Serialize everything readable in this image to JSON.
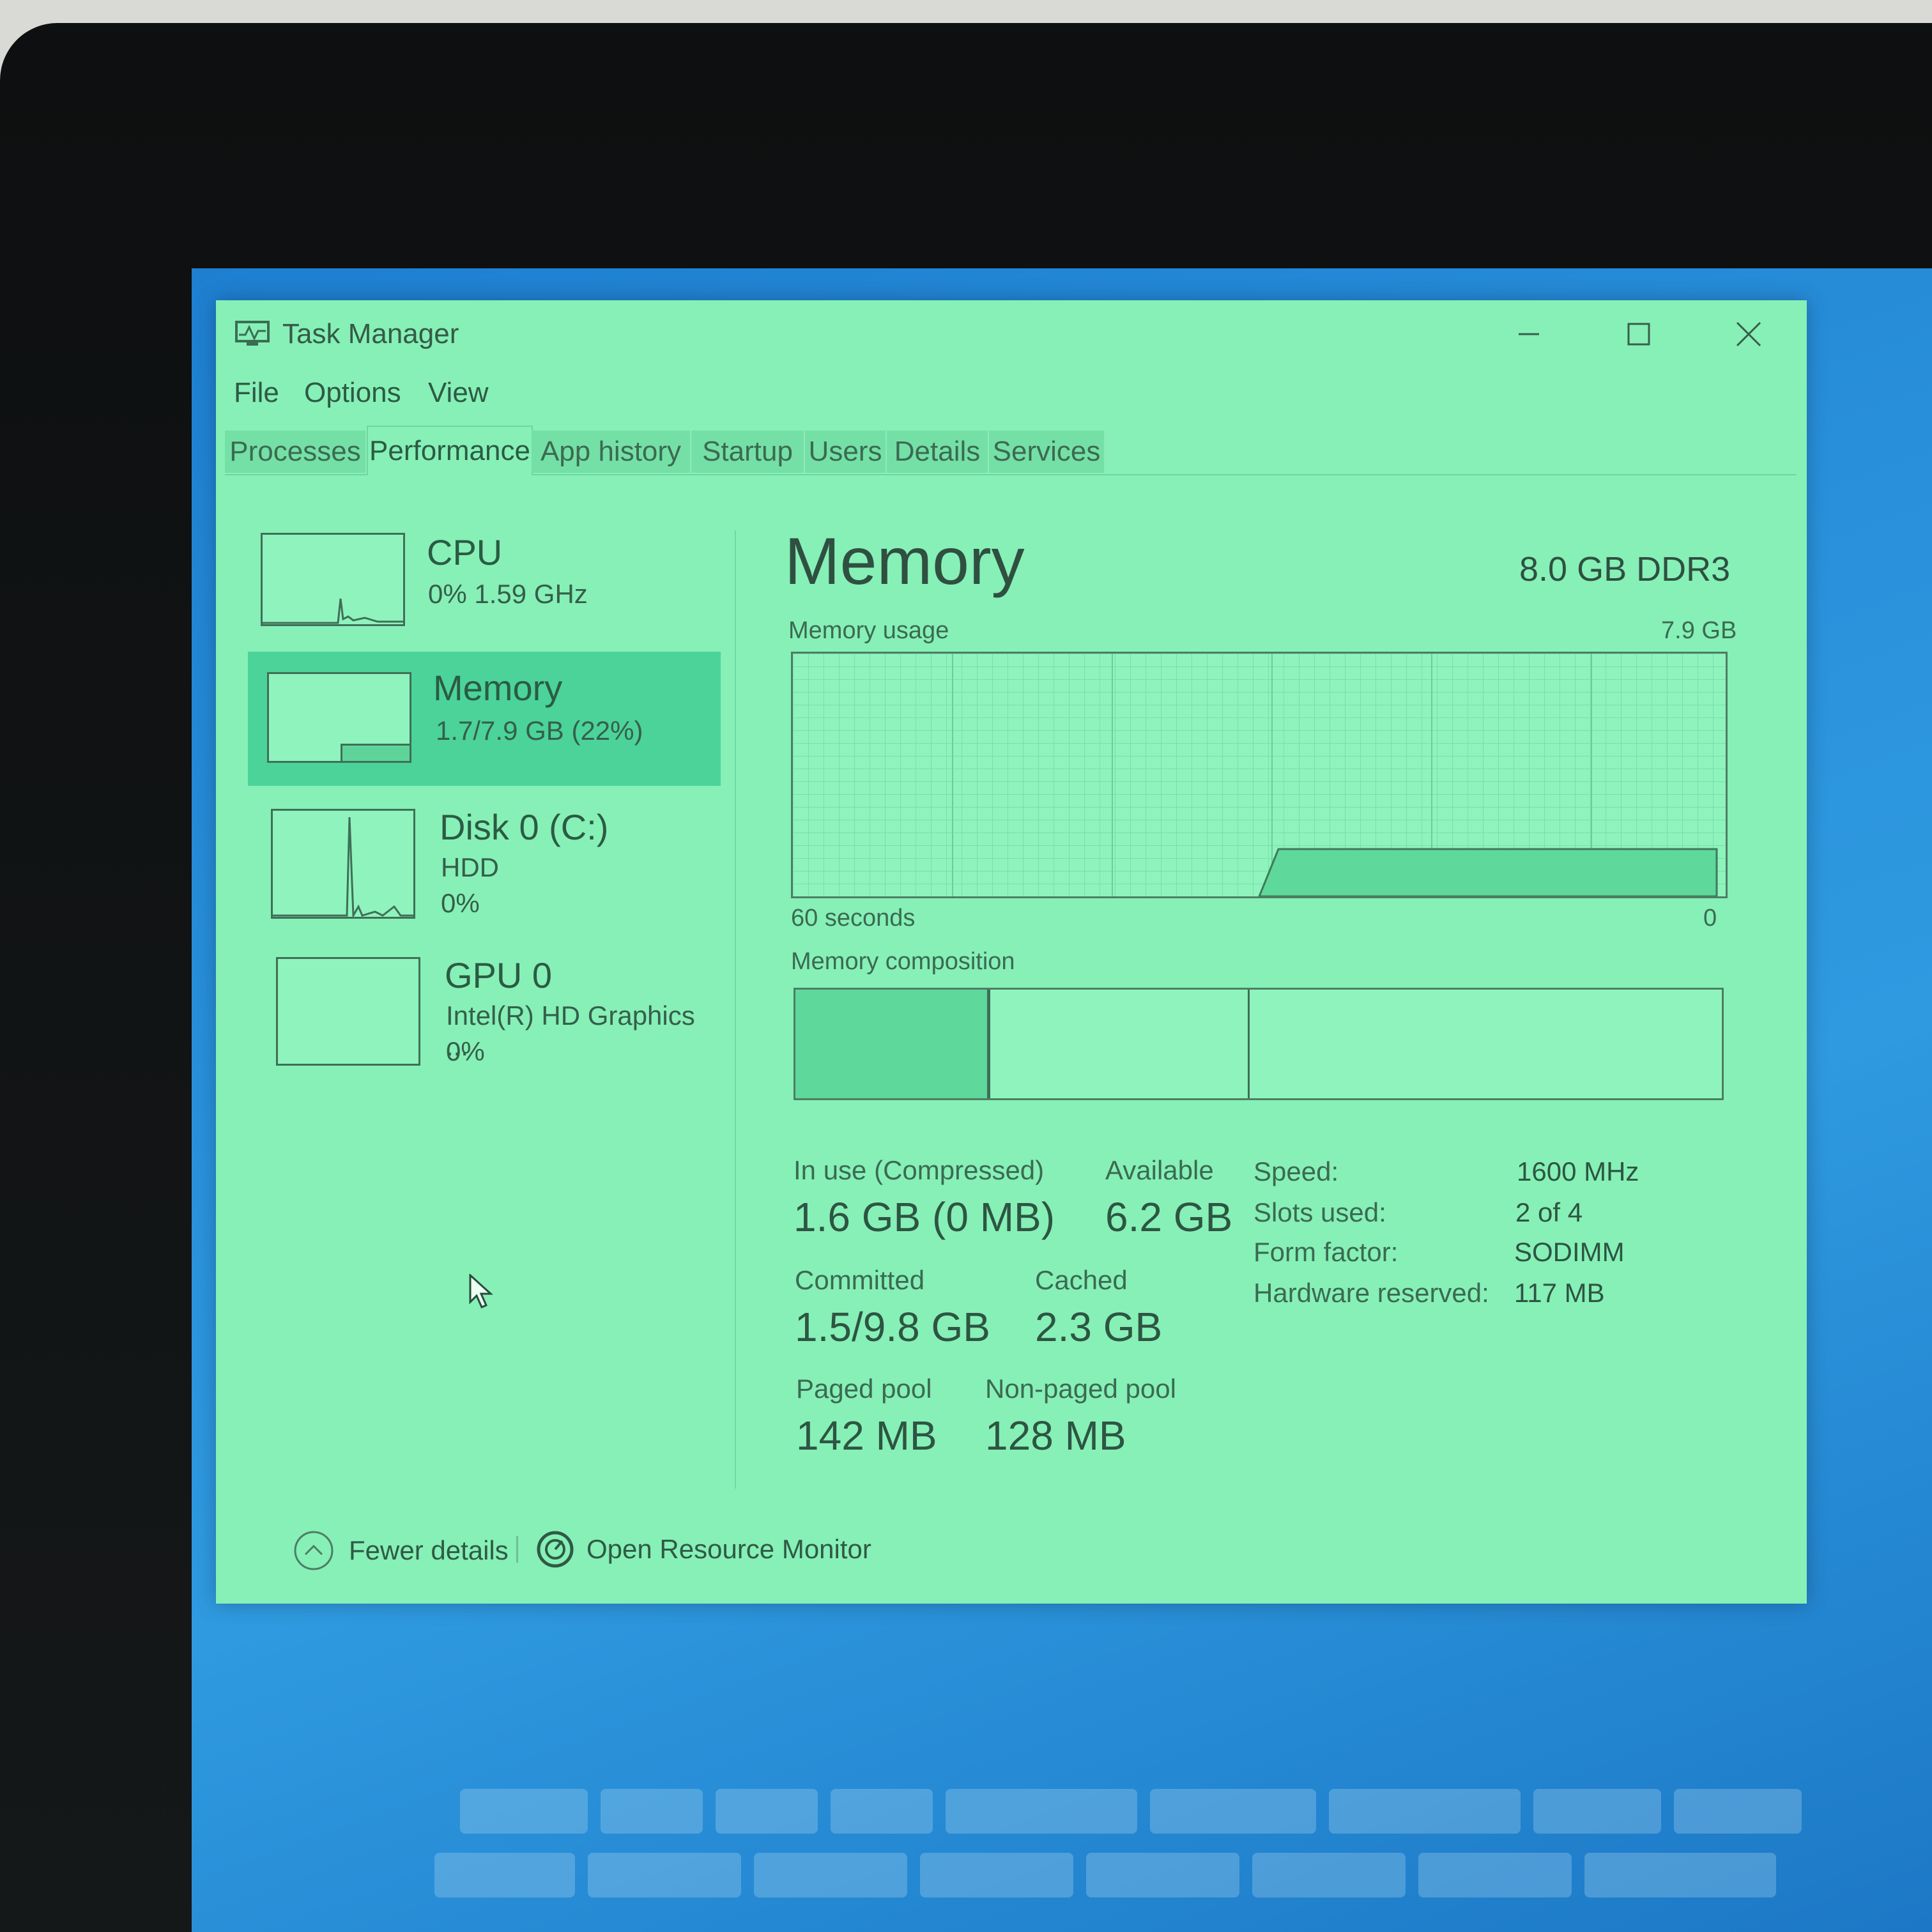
{
  "window": {
    "title": "Task Manager",
    "menu": [
      "File",
      "Options",
      "View"
    ],
    "tabs": [
      "Processes",
      "Performance",
      "App history",
      "Startup",
      "Users",
      "Details",
      "Services"
    ],
    "active_tab": "Performance"
  },
  "sidebar": {
    "items": [
      {
        "title": "CPU",
        "line1": "0%  1.59 GHz",
        "line2": ""
      },
      {
        "title": "Memory",
        "line1": "1.7/7.9 GB (22%)",
        "line2": "",
        "selected": true
      },
      {
        "title": "Disk 0 (C:)",
        "line1": "HDD",
        "line2": "0%"
      },
      {
        "title": "GPU 0",
        "line1": "Intel(R) HD Graphics ...",
        "line2": "0%"
      }
    ]
  },
  "memory": {
    "heading": "Memory",
    "type": "8.0 GB DDR3",
    "usage_label": "Memory usage",
    "usage_max": "7.9 GB",
    "time_span": "60 seconds",
    "axis_zero": "0",
    "composition_label": "Memory composition",
    "stats": {
      "in_use_label": "In use (Compressed)",
      "in_use_value": "1.6 GB (0 MB)",
      "available_label": "Available",
      "available_value": "6.2 GB",
      "committed_label": "Committed",
      "committed_value": "1.5/9.8 GB",
      "cached_label": "Cached",
      "cached_value": "2.3 GB",
      "paged_label": "Paged pool",
      "paged_value": "142 MB",
      "nonpaged_label": "Non-paged pool",
      "nonpaged_value": "128 MB"
    },
    "specs": [
      {
        "key": "Speed:",
        "value": "1600 MHz"
      },
      {
        "key": "Slots used:",
        "value": "2 of 4"
      },
      {
        "key": "Form factor:",
        "value": "SODIMM"
      },
      {
        "key": "Hardware reserved:",
        "value": "117 MB"
      }
    ]
  },
  "footer": {
    "fewer_details": "Fewer details",
    "open_monitor": "Open Resource Monitor"
  },
  "colors": {
    "window_bg": "#86f0b7",
    "selected_bg": "#4bd39a",
    "desktop": "#2a92dc"
  },
  "icons": [
    "task-manager-icon",
    "minimize-icon",
    "maximize-icon",
    "close-icon",
    "chevron-up-icon",
    "resource-monitor-icon",
    "mouse-cursor-icon"
  ]
}
